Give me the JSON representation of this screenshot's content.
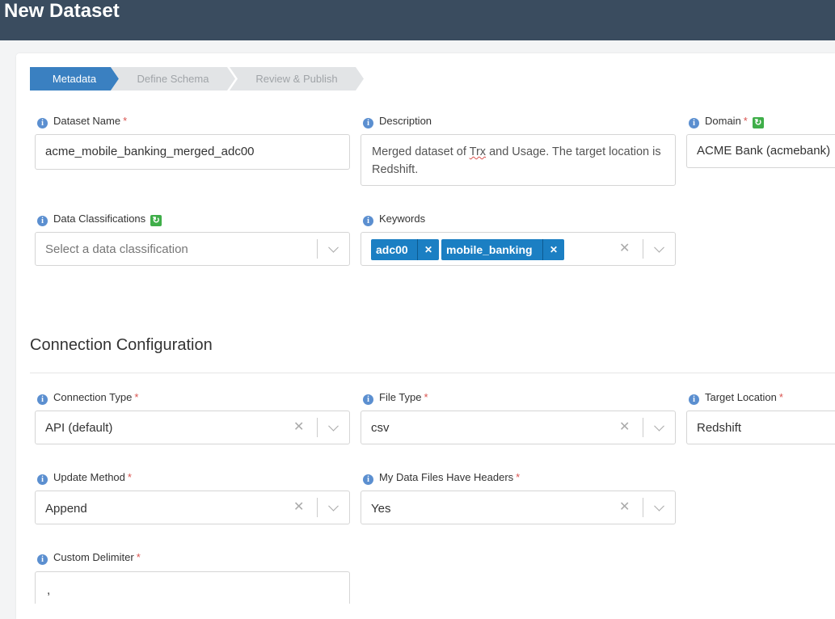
{
  "header": {
    "title": "New Dataset"
  },
  "wizard": {
    "steps": [
      "Metadata",
      "Define Schema",
      "Review & Publish"
    ],
    "active": "Metadata"
  },
  "form": {
    "dataset_name": {
      "label": "Dataset Name",
      "value": "acme_mobile_banking_merged_adc00",
      "required": "*"
    },
    "description": {
      "label": "Description",
      "value_pre": "Merged dataset of ",
      "value_mid": "Trx",
      "value_post": " and Usage. The target location is Redshift."
    },
    "domain": {
      "label": "Domain",
      "value": "ACME Bank (acmebank)",
      "required": "*"
    },
    "data_classifications": {
      "label": "Data Classifications",
      "placeholder": "Select a data classification"
    },
    "keywords": {
      "label": "Keywords",
      "tags": [
        "adc00",
        "mobile_banking"
      ]
    },
    "connection_section_title": "Connection Configuration",
    "connection_type": {
      "label": "Connection Type",
      "value": "API (default)",
      "required": "*"
    },
    "file_type": {
      "label": "File Type",
      "value": "csv",
      "required": "*"
    },
    "target_location": {
      "label": "Target Location",
      "value": "Redshift",
      "required": "*"
    },
    "update_method": {
      "label": "Update Method",
      "value": "Append",
      "required": "*"
    },
    "headers": {
      "label": "My Data Files Have Headers",
      "value": "Yes",
      "required": "*"
    },
    "custom_delimiter": {
      "label": "Custom Delimiter",
      "value": ",",
      "required": "*"
    }
  },
  "icons": {
    "info": "info-icon",
    "refresh": "refresh-icon",
    "clear": "clear-icon",
    "dropdown": "chevron-down-icon"
  },
  "colors": {
    "header_bg": "#3a4c5f",
    "active_step": "#3a80c1",
    "tag_bg": "#1b7fc3",
    "required": "#d9534f",
    "refresh": "#3fae49"
  }
}
